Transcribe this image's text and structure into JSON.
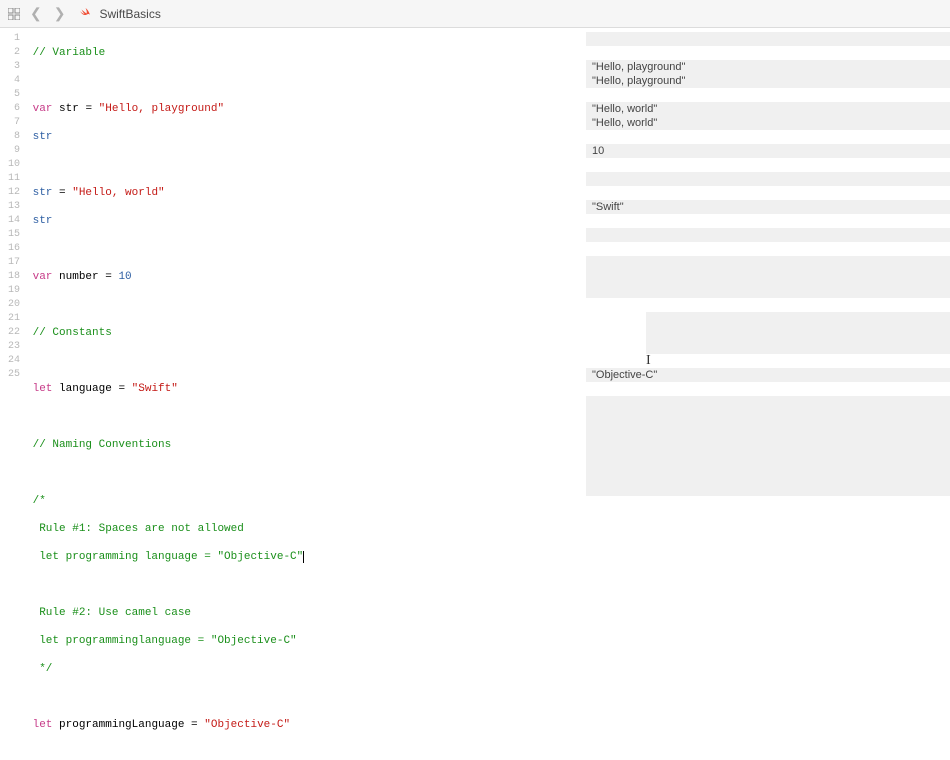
{
  "toolbar": {
    "file_name": "SwiftBasics"
  },
  "code": {
    "l1": {
      "comment": "// Variable"
    },
    "l3": {
      "kw": "var",
      "name": "str",
      "eq": " = ",
      "str": "\"Hello, playground\""
    },
    "l4": {
      "ident": "str"
    },
    "l6": {
      "ident": "str",
      "eq": " = ",
      "str": "\"Hello, world\""
    },
    "l7": {
      "ident": "str"
    },
    "l9": {
      "kw": "var",
      "name": "number",
      "eq": " = ",
      "num": "10"
    },
    "l11": {
      "comment": "// Constants"
    },
    "l13": {
      "kw": "let",
      "name": "language",
      "eq": " = ",
      "str": "\"Swift\""
    },
    "l15": {
      "comment": "// Naming Conventions"
    },
    "l17": {
      "comment": "/*"
    },
    "l18": {
      "comment": " Rule #1: Spaces are not allowed"
    },
    "l19": {
      "comment": " let programming language = \"Objective-C\""
    },
    "l21": {
      "comment": " Rule #2: Use camel case"
    },
    "l22": {
      "comment": " let programminglanguage = \"Objective-C\""
    },
    "l23": {
      "comment": " */"
    },
    "l25": {
      "kw": "let",
      "name": "programmingLanguage",
      "eq": " = ",
      "str": "\"Objective-C\""
    }
  },
  "results": {
    "r3": "\"Hello, playground\"",
    "r4": "\"Hello, playground\"",
    "r6": "\"Hello, world\"",
    "r7": "\"Hello, world\"",
    "r9": "10",
    "r13": "\"Swift\"",
    "r25": "\"Objective-C\""
  },
  "line_numbers": [
    "1",
    "2",
    "3",
    "4",
    "5",
    "6",
    "7",
    "8",
    "9",
    "10",
    "11",
    "12",
    "13",
    "14",
    "15",
    "16",
    "17",
    "18",
    "19",
    "20",
    "21",
    "22",
    "23",
    "24",
    "25"
  ]
}
